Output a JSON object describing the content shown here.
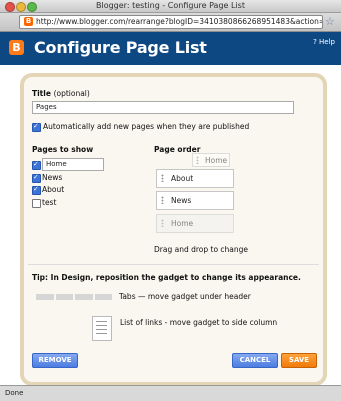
{
  "window": {
    "title": "Blogger: testing - Configure Page List"
  },
  "browser": {
    "url": "http://www.blogger.com/rearrange?blogID=3410380866268951483&action=edi"
  },
  "header": {
    "title": "Configure Page List",
    "help": "? Help"
  },
  "form": {
    "title_label": "Title",
    "title_optional": "(optional)",
    "title_value": "Pages",
    "auto_add_label": "Automatically add new pages when they are published",
    "auto_add_checked": true,
    "pages_to_show_label": "Pages to show",
    "pages_to_show": [
      {
        "label": "Home",
        "checked": true,
        "editable": true
      },
      {
        "label": "News",
        "checked": true
      },
      {
        "label": "About",
        "checked": true
      },
      {
        "label": "test",
        "checked": false
      }
    ],
    "page_order_label": "Page order",
    "page_order": [
      "About",
      "News",
      "Home"
    ],
    "dragging_item": "Home",
    "drag_hint": "Drag and drop to change",
    "tip": "Tip: In Design, reposition the gadget to change its appearance.",
    "tabs_hint": "Tabs — move gadget under header",
    "list_hint": "List of links - move gadget to side column"
  },
  "buttons": {
    "remove": "REMOVE",
    "cancel": "CANCEL",
    "save": "SAVE"
  },
  "status": {
    "text": "Done"
  }
}
